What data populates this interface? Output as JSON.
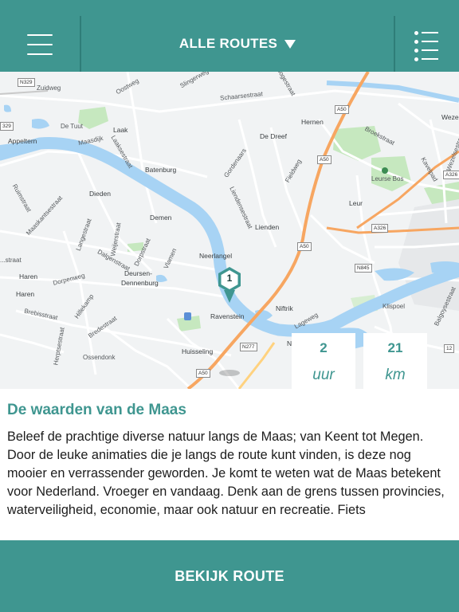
{
  "header": {
    "title": "ALLE ROUTES",
    "menu_icon": "hamburger-icon",
    "dropdown_icon": "triangle-down-icon",
    "list_icon": "list-icon"
  },
  "map": {
    "marker_number": "1",
    "road_labels": {
      "n329": "N329",
      "r329": "329",
      "a50a": "A50",
      "a50b": "A50",
      "a50c": "A50",
      "a326a": "A326",
      "a326b": "A326",
      "n845": "N845",
      "n277": "N277",
      "a50d": "A50",
      "r12": "12"
    },
    "places": {
      "zuidweg": "Zuidweg",
      "oostweg": "Oostweg",
      "slingerweg": "Slingerweg",
      "schaarsestraat": "Schaarsestraat",
      "hoogestraat": "Hoogestraat",
      "wezel": "Wezel",
      "de_tuut": "De Tuut",
      "appeltern": "Appeltern",
      "maasdijk": "Maasdijk",
      "laak": "Laak",
      "laakse": "Laaksestraat",
      "hernen": "Hernen",
      "broekstraat": "Broekstraat",
      "de_dreef": "De Dreef",
      "batenburg": "Batenburg",
      "gordenaars": "Gordenaars",
      "fietsroute": "Fieldweg",
      "leurse_bos": "Leurse Bos",
      "kavelpad": "Kavelpad",
      "wezelsestraat": "Wezelsestraat",
      "dieden": "Dieden",
      "ruimstraat": "Ruimstraat",
      "maaskantse": "Maaskantsestraat",
      "leur": "Leur",
      "lienden_str": "Liendensestraat",
      "lienden": "Lienden",
      "demen": "Demen",
      "langestraat": "Langestraat",
      "weijerstraat": "Weijerstraat",
      "dalgen": "Dalgenstraat",
      "dorpstraat": "Dorpstraat",
      "vlamen": "Vlamen",
      "neerlangel": "Neerlangel",
      "lstraat": "...straat",
      "haren1": "Haren",
      "dorpenweg": "Dorpenweg",
      "deursen": "Deursen-",
      "dennenburg": "Dennenburg",
      "haren2": "Haren",
      "niftrik": "Niftrik",
      "klispoel": "Klispoel",
      "balgoy": "Balgoysestraat",
      "brebisstraat": "Brebisstraat",
      "hillekamp": "Hillekamp",
      "bredestraat": "Bredestraat",
      "ravenstein": "Ravenstein",
      "lageweg": "Lageweg",
      "herpt": "Herptsestraat",
      "ossendonk": "Ossendonk",
      "huisseling": "Huisseling",
      "n_letter": "N"
    }
  },
  "stats": {
    "duration_value": "2",
    "duration_unit": "uur",
    "distance_value": "21",
    "distance_unit": "km"
  },
  "route": {
    "title": "De waarden van de Maas",
    "description": "Beleef de prachtige diverse natuur langs de Maas; van Keent tot Megen. Door de leuke animaties die je langs de route kunt vinden, is deze nog mooier en verrassender geworden. Je komt te weten wat de Maas betekent voor Nederland. Vroeger en vandaag. Denk aan de grens tussen provincies, waterveiligheid, economie, maar ook natuur en recreatie. Fiets"
  },
  "cta": {
    "label": "BEKIJK ROUTE"
  },
  "colors": {
    "brand": "#3f9690",
    "water": "#a7d3f4",
    "highway": "#f7a661",
    "green": "#c6e8bf"
  }
}
